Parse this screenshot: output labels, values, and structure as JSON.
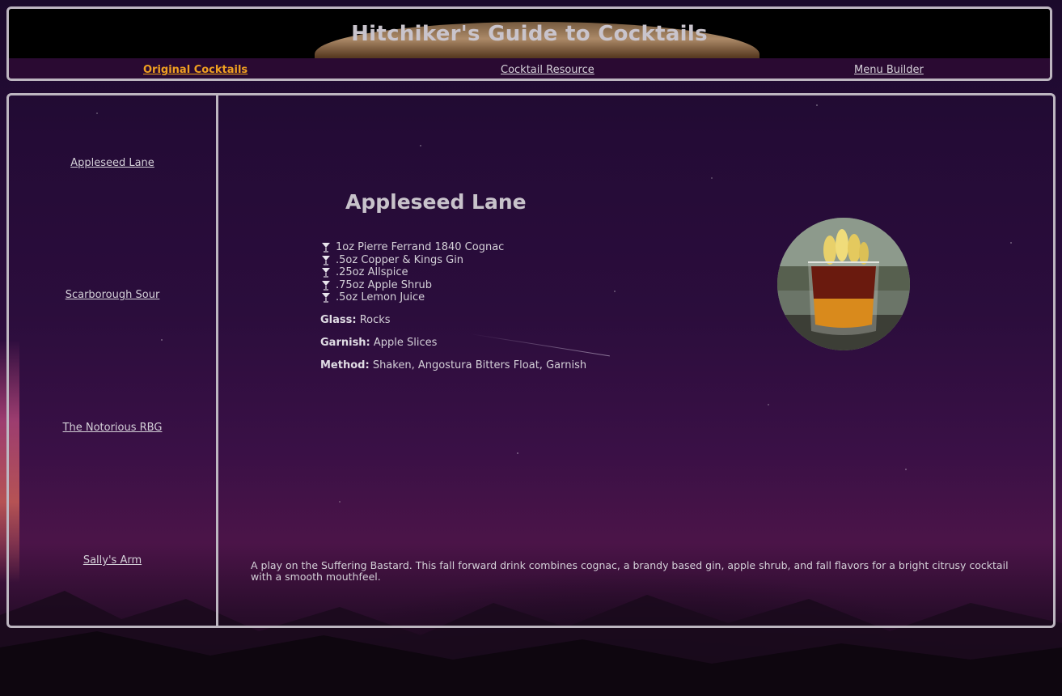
{
  "header": {
    "title": "Hitchiker's Guide to Cocktails"
  },
  "nav": {
    "items": [
      {
        "label": "Original Cocktails",
        "active": true
      },
      {
        "label": "Cocktail Resource",
        "active": false
      },
      {
        "label": "Menu Builder",
        "active": false
      }
    ]
  },
  "sidebar": {
    "items": [
      {
        "label": "Appleseed Lane"
      },
      {
        "label": "Scarborough Sour"
      },
      {
        "label": "The Notorious RBG"
      },
      {
        "label": "Sally's Arm"
      }
    ]
  },
  "drink": {
    "name": "Appleseed Lane",
    "ingredients": [
      "1oz Pierre Ferrand 1840 Cognac",
      ".5oz Copper & Kings Gin",
      ".25oz Allspice",
      ".75oz Apple Shrub",
      ".5oz Lemon Juice"
    ],
    "glass_label": "Glass:",
    "glass": "Rocks",
    "garnish_label": "Garnish:",
    "garnish": "Apple Slices",
    "method_label": "Method:",
    "method": "Shaken, Angostura Bitters Float, Garnish",
    "description": "A play on the Suffering Bastard. This fall forward drink combines cognac, a brandy based gin, apple shrub, and fall flavors for a bright citrusy cocktail with a smooth mouthfeel."
  },
  "colors": {
    "active_nav": "#f0a020",
    "border": "#bdb6c0",
    "nav_bg": "#2a0a32"
  }
}
